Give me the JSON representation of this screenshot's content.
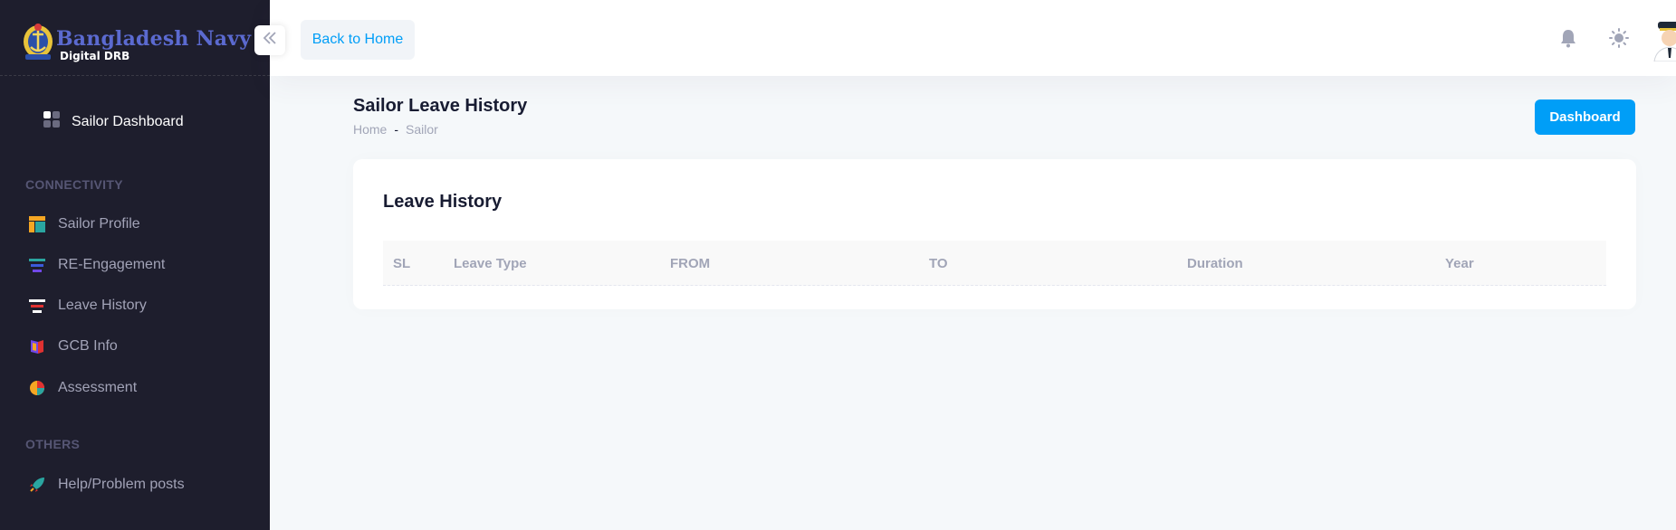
{
  "brand": {
    "title": "Bangladesh Navy",
    "subtitle": "Digital DRB"
  },
  "sidebar": {
    "dashboard_label": "Sailor Dashboard",
    "sections": [
      {
        "title": "CONNECTIVITY",
        "items": [
          {
            "label": "Sailor Profile",
            "icon": "layout-icon"
          },
          {
            "label": "RE-Engagement",
            "icon": "stack-icon"
          },
          {
            "label": "Leave History",
            "icon": "list-icon"
          },
          {
            "label": "GCB Info",
            "icon": "book-icon"
          },
          {
            "label": "Assessment",
            "icon": "pie-icon"
          }
        ]
      },
      {
        "title": "OTHERS",
        "items": [
          {
            "label": "Help/Problem posts",
            "icon": "rocket-icon"
          }
        ]
      }
    ]
  },
  "header": {
    "back_label": "Back to Home"
  },
  "toolbar": {
    "page_title": "Sailor Leave History",
    "breadcrumb": [
      "Home",
      "-",
      "Sailor"
    ],
    "dashboard_button": "Dashboard"
  },
  "card": {
    "title": "Leave History",
    "columns": [
      "SL",
      "Leave Type",
      "FROM",
      "TO",
      "Duration",
      "Year"
    ],
    "rows": []
  },
  "colors": {
    "sidebar_bg": "#1e1e2d",
    "primary": "#009ef7",
    "page_bg": "#f5f8fa"
  }
}
